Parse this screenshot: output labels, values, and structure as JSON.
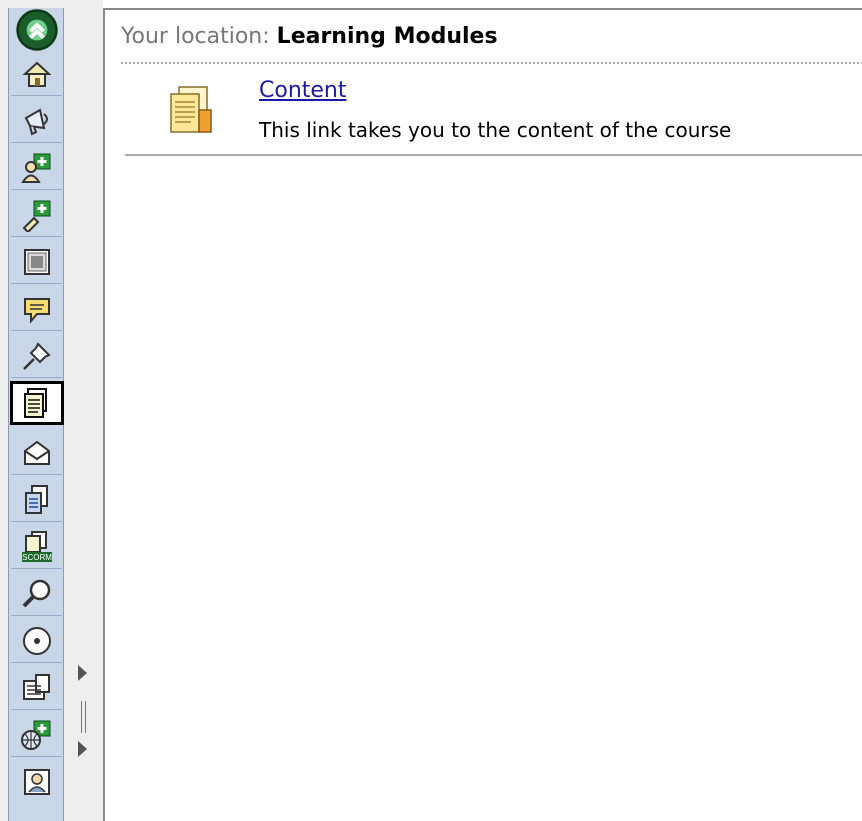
{
  "toolbar": {
    "items": [
      {
        "icon": "collapse-icon"
      },
      {
        "icon": "home-icon"
      },
      {
        "icon": "announcements-icon"
      },
      {
        "icon": "group-add-icon"
      },
      {
        "icon": "user-add-icon"
      },
      {
        "icon": "calendar-icon"
      },
      {
        "icon": "chat-icon"
      },
      {
        "icon": "pin-icon"
      },
      {
        "icon": "learning-modules-icon",
        "active": true
      },
      {
        "icon": "mail-icon"
      },
      {
        "icon": "documents-icon"
      },
      {
        "icon": "scorm-icon",
        "label": "SCORM"
      },
      {
        "icon": "search-icon"
      },
      {
        "icon": "cd-icon"
      },
      {
        "icon": "copy-icon"
      },
      {
        "icon": "web-group-icon"
      },
      {
        "icon": "profile-icon"
      }
    ]
  },
  "location": {
    "label": "Your location:",
    "value": "Learning Modules"
  },
  "content_item": {
    "icon": "document-pages-icon",
    "link": "Content",
    "description": "This link takes you to the content of the course"
  },
  "colors": {
    "toolbar_bg": "#c9d6e8",
    "link": "#1a1aa6",
    "location_label": "#777777"
  }
}
